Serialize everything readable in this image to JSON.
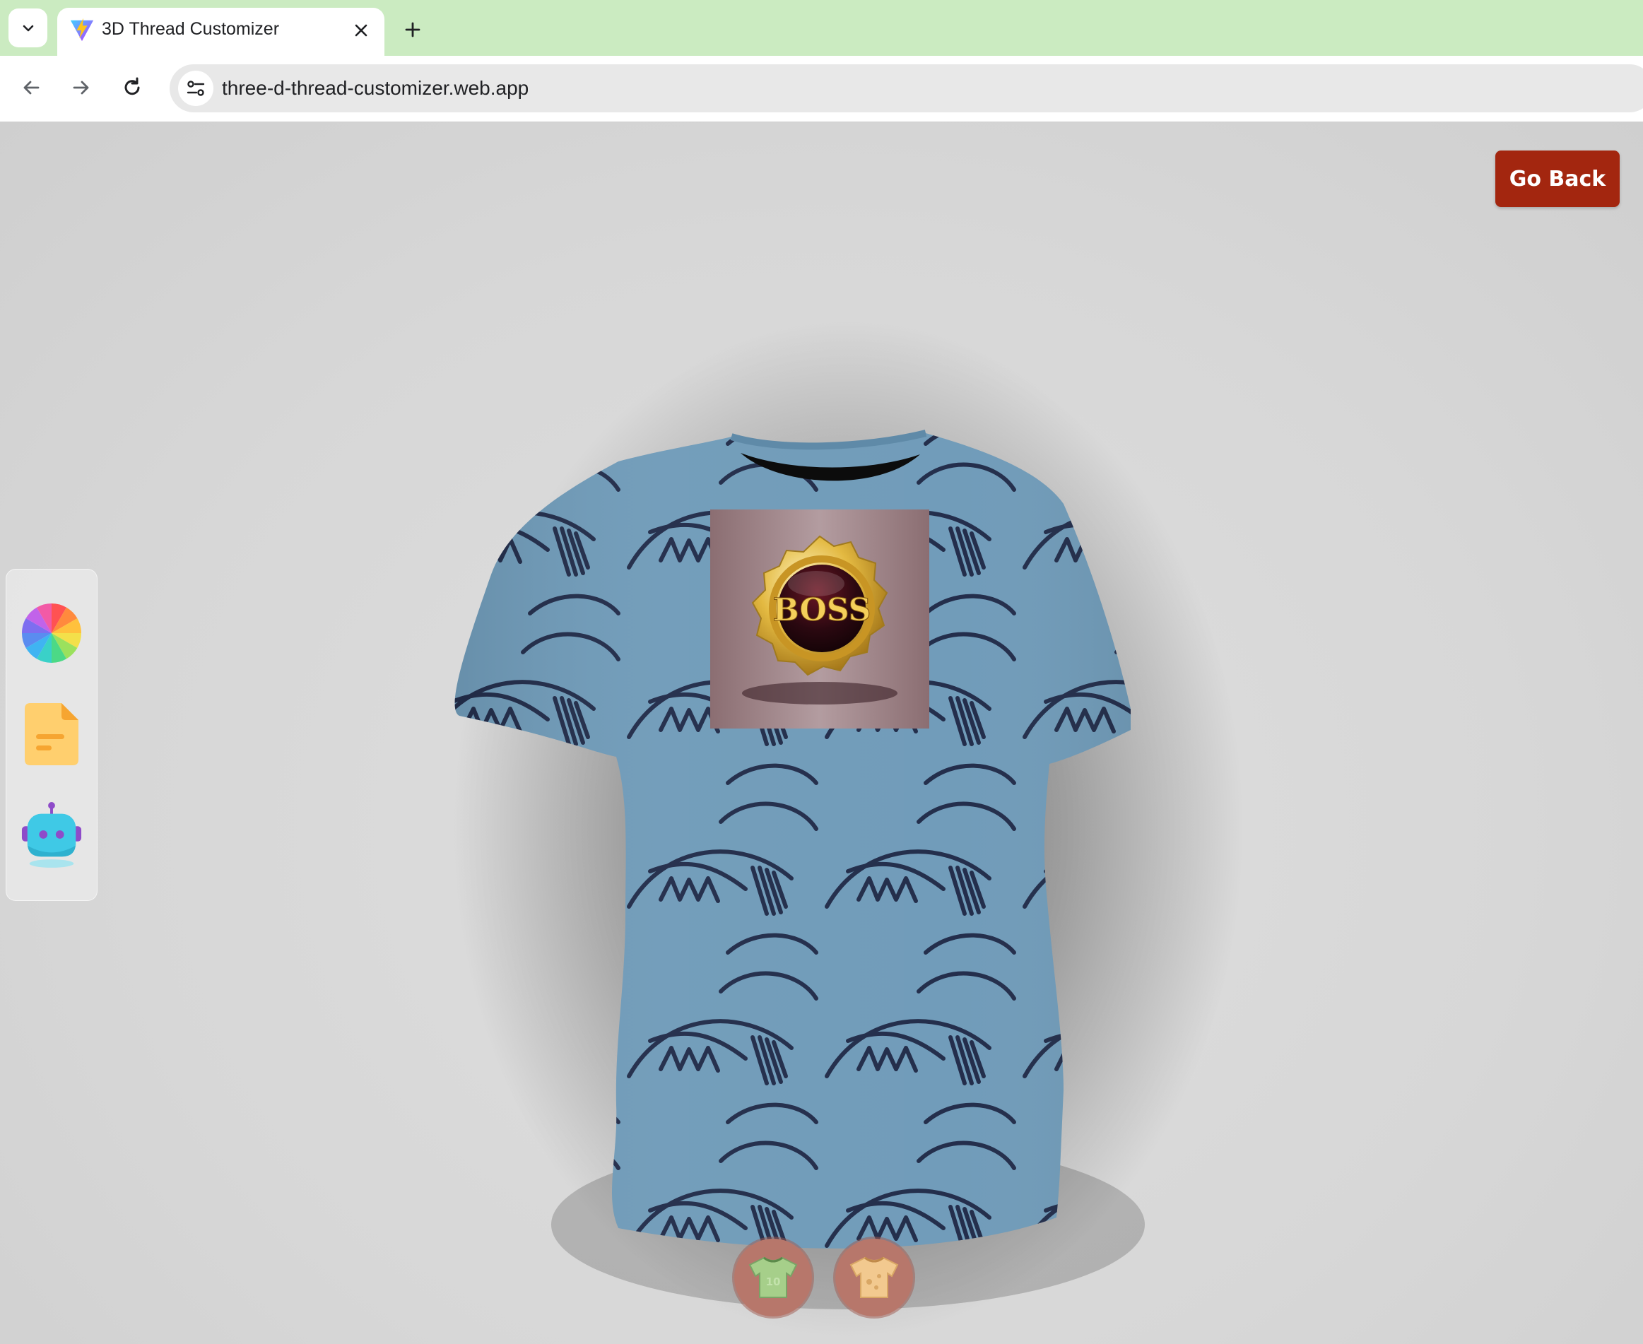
{
  "browser": {
    "tab_title": "3D Thread Customizer",
    "url": "three-d-thread-customizer.web.app"
  },
  "app": {
    "go_back_label": "Go Back",
    "accent_color": "#a3260f",
    "shirt_color": "#6e9ab8",
    "pattern_color": "#1f2a48",
    "logo_text": "BOSS",
    "filter_tab_number": "10",
    "side_tools": [
      "color-picker-icon",
      "file-picker-icon",
      "ai-picker-icon"
    ],
    "filter_tabs": [
      "logo-shirt-icon",
      "stylish-shirt-icon"
    ]
  }
}
